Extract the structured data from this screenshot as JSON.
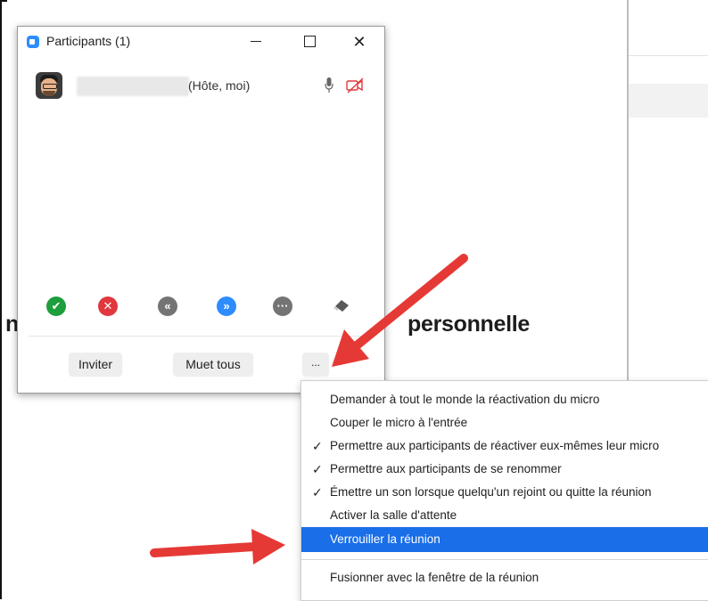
{
  "panel": {
    "title": "Participants (1)",
    "window_controls": {
      "minimize": "minimize-icon",
      "maximize": "maximize-icon",
      "close": "✕"
    },
    "participant": {
      "name_suffix": "(Hôte, moi)",
      "icons": [
        "avatar",
        "microphone-icon",
        "video-off-icon"
      ]
    },
    "reactions": [
      {
        "name": "yes",
        "glyph": "✔",
        "color": "#1e9e3c"
      },
      {
        "name": "no",
        "glyph": "✕",
        "color": "#e0383e"
      },
      {
        "name": "go-slower",
        "glyph": "«",
        "color": "#747474"
      },
      {
        "name": "go-faster",
        "glyph": "»",
        "color": "#2d8cff"
      },
      {
        "name": "more",
        "glyph": "···",
        "color": "#747474"
      },
      {
        "name": "clear-all",
        "glyph": "eraser-icon",
        "color": "#5a5a5a"
      }
    ],
    "buttons": {
      "invite": "Inviter",
      "mute_all": "Muet tous",
      "more": "..."
    }
  },
  "background": {
    "heading_fragment": "personnelle",
    "left_fragment": "n"
  },
  "menu": {
    "items": [
      {
        "label": "Demander à tout le monde la réactivation du micro",
        "checked": false
      },
      {
        "label": "Couper le micro à l'entrée",
        "checked": false
      },
      {
        "label": "Permettre aux participants de réactiver eux-mêmes leur micro",
        "checked": true
      },
      {
        "label": "Permettre aux participants de se renommer",
        "checked": true
      },
      {
        "label": "Émettre un son lorsque quelqu'un rejoint ou quitte la réunion",
        "checked": true
      },
      {
        "label": "Activer la salle d'attente",
        "checked": false
      },
      {
        "label": "Verrouiller la réunion",
        "checked": false,
        "highlighted": true
      },
      {
        "label": "Fusionner avec la fenêtre de la réunion",
        "checked": false
      }
    ],
    "check_glyph": "✓"
  },
  "colors": {
    "accent": "#2d8cff",
    "menu_highlight": "#1a6ee8",
    "arrow": "#e53935"
  }
}
